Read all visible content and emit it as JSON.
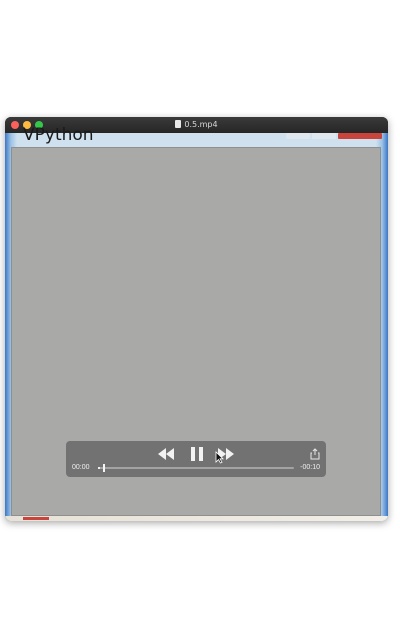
{
  "window": {
    "title": "0.5.mp4"
  },
  "background_app": {
    "title": "VPython"
  },
  "player": {
    "time_elapsed": "00:00",
    "time_remaining": "-00:10",
    "progress": 0.01,
    "state": "playing",
    "icons": {
      "rewind": "rewind-icon",
      "pause": "pause-icon",
      "forward": "fast-forward-icon",
      "share": "share-icon"
    }
  },
  "colors": {
    "canvas": "#a9a9a8",
    "controls_bg": "#6e6e6e",
    "close_red": "#c9453b"
  }
}
